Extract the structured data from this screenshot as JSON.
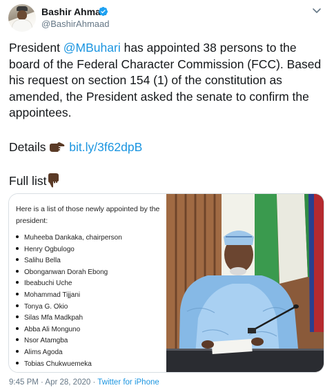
{
  "author": {
    "name": "Bashir Ahmad",
    "handle": "@BashirAhmaad"
  },
  "tweet": {
    "text_prefix": "President ",
    "mention": "@MBuhari",
    "text_rest": " has appointed 38 persons to the board of the Federal Character Commission (FCC). Based his request on section 154 (1) of the constitution as amended, the President asked the senate to confirm the appointees.",
    "details_label": "Details",
    "details_link": "bit.ly/3f62dpB",
    "full_list_label": "Full list"
  },
  "media": {
    "list_title": "Here is a list of those newly appointed by the president:",
    "appointees": [
      "Muheeba Dankaka, chairperson",
      "Henry Ogbulogo",
      "Salihu Bella",
      "Obonganwan Dorah Ebong",
      "Ibeabuchi Uche",
      "Mohammad Tijjani",
      "Tonya G. Okio",
      "Silas Mfa Madkpah",
      "Abba Ali Monguno",
      "Nsor Atamgba",
      "Alims Agoda",
      "Tobias Chukwuemeka"
    ]
  },
  "footer": {
    "timestamp": "9:45 PM · Apr 28, 2020 · ",
    "source": "Twitter for iPhone"
  },
  "colors": {
    "link": "#1b95e0",
    "muted": "#657786",
    "text": "#14171a"
  },
  "icons": [
    "verified-badge-icon",
    "chevron-down-icon",
    "pointing-right-hand-icon",
    "pointing-down-hand-icon"
  ]
}
